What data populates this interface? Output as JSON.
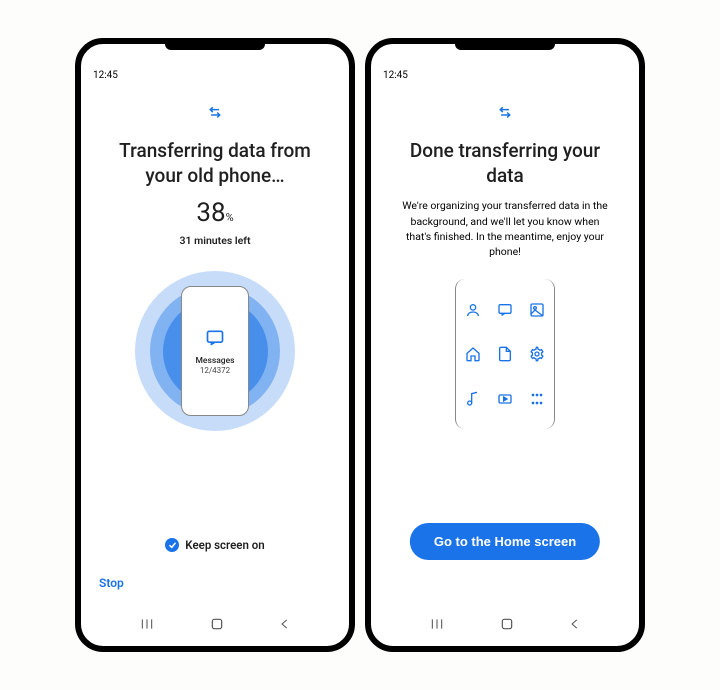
{
  "status_time": "12:45",
  "left": {
    "title": "Transferring data from your old phone…",
    "percent_value": "38",
    "percent_unit": "%",
    "time_left": "31 minutes left",
    "current_item_label": "Messages",
    "current_item_progress": "12/4372",
    "keep_screen_label": "Keep screen on",
    "keep_screen_checked": true,
    "stop_label": "Stop"
  },
  "right": {
    "title": "Done transferring your data",
    "description": "We're organizing your transferred data in the background, and we'll let you know when that's finished. In the meantime, enjoy your phone!",
    "cta_label": "Go to the Home screen",
    "grid_icons": [
      "contacts",
      "messages",
      "photos",
      "home",
      "files",
      "settings",
      "music",
      "video",
      "apps"
    ]
  }
}
